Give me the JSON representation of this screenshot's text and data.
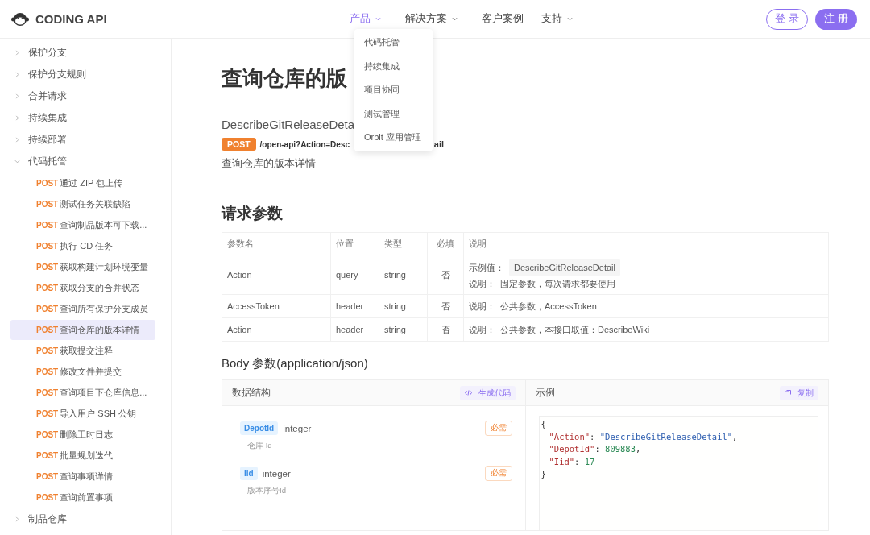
{
  "header": {
    "logo": "CODING API",
    "nav": [
      {
        "label": "产品",
        "selected": true,
        "caret": true
      },
      {
        "label": "解决方案",
        "selected": false,
        "caret": true
      },
      {
        "label": "客户案例",
        "selected": false,
        "caret": false
      },
      {
        "label": "支持",
        "selected": false,
        "caret": true
      }
    ],
    "login": "登 录",
    "register": "注 册"
  },
  "dropdown": [
    "代码托管",
    "持续集成",
    "项目协同",
    "测试管理",
    "Orbit 应用管理"
  ],
  "sidebar": [
    {
      "label": "保护分支",
      "expanded": false
    },
    {
      "label": "保护分支规则",
      "expanded": false
    },
    {
      "label": "合并请求",
      "expanded": false
    },
    {
      "label": "持续集成",
      "expanded": false
    },
    {
      "label": "持续部署",
      "expanded": false
    },
    {
      "label": "代码托管",
      "expanded": true,
      "children": [
        {
          "method": "POST",
          "label": "通过 ZIP 包上传",
          "selected": false
        },
        {
          "method": "POST",
          "label": "测试任务关联缺陷",
          "selected": false
        },
        {
          "method": "POST",
          "label": "查询制品版本可下载...",
          "selected": false
        },
        {
          "method": "POST",
          "label": "执行 CD 任务",
          "selected": false
        },
        {
          "method": "POST",
          "label": "获取构建计划环境变量",
          "selected": false
        },
        {
          "method": "POST",
          "label": "获取分支的合并状态",
          "selected": false
        },
        {
          "method": "POST",
          "label": "查询所有保护分支成员",
          "selected": false
        },
        {
          "method": "POST",
          "label": "查询仓库的版本详情",
          "selected": true
        },
        {
          "method": "POST",
          "label": "获取提交注释",
          "selected": false
        },
        {
          "method": "POST",
          "label": "修改文件并提交",
          "selected": false
        },
        {
          "method": "POST",
          "label": "查询项目下仓库信息...",
          "selected": false
        },
        {
          "method": "POST",
          "label": "导入用户 SSH 公钥",
          "selected": false
        },
        {
          "method": "POST",
          "label": "删除工时日志",
          "selected": false
        },
        {
          "method": "POST",
          "label": "批量规划迭代",
          "selected": false
        },
        {
          "method": "POST",
          "label": "查询事项详情",
          "selected": false
        },
        {
          "method": "POST",
          "label": "查询前置事项",
          "selected": false
        }
      ]
    },
    {
      "label": "制品仓库",
      "expanded": false
    }
  ],
  "page": {
    "title": "查询仓库的版",
    "action": "DescribeGitReleaseDeta",
    "method": "POST",
    "path": "/open-api?Action=Desc",
    "path_tail": "ail",
    "description": "查询仓库的版本详情"
  },
  "params": {
    "heading": "请求参数",
    "columns": [
      "参数名",
      "位置",
      "类型",
      "必填",
      "说明"
    ],
    "rows": [
      {
        "name": "Action",
        "in": "query",
        "type": "string",
        "required": "否",
        "notes": [
          {
            "kind": "example",
            "label": "示例值：",
            "value": "DescribeGitReleaseDetail"
          },
          {
            "kind": "note",
            "label": "说明：",
            "value": "固定参数，每次请求都要使用"
          }
        ]
      },
      {
        "name": "AccessToken",
        "in": "header",
        "type": "string",
        "required": "否",
        "notes": [
          {
            "kind": "note",
            "label": "说明：",
            "value": "公共参数，AccessToken"
          }
        ]
      },
      {
        "name": "Action",
        "in": "header",
        "type": "string",
        "required": "否",
        "notes": [
          {
            "kind": "note",
            "label": "说明：",
            "value": "公共参数，本接口取值：DescribeWiki"
          }
        ]
      }
    ]
  },
  "body": {
    "heading": "Body 参数(application/json)",
    "schema_title": "数据结构",
    "generate": "生成代码",
    "example_title": "示例",
    "copy": "复制",
    "fields": [
      {
        "name": "DepotId",
        "type": "integer",
        "required": "必需",
        "description": "仓库 Id"
      },
      {
        "name": "Iid",
        "type": "integer",
        "required": "必需",
        "description": "版本序号Id"
      }
    ],
    "code": [
      [
        {
          "kind": "punct",
          "text": "{"
        }
      ],
      [
        {
          "kind": "key",
          "text": "\"Action\""
        },
        {
          "kind": "punct",
          "text": ": "
        },
        {
          "kind": "string",
          "text": "\"DescribeGitReleaseDetail\""
        },
        {
          "kind": "punct",
          "text": ","
        }
      ],
      [
        {
          "kind": "key",
          "text": "\"DepotId\""
        },
        {
          "kind": "punct",
          "text": ": "
        },
        {
          "kind": "number",
          "text": "809883"
        },
        {
          "kind": "punct",
          "text": ","
        }
      ],
      [
        {
          "kind": "key",
          "text": "\"Iid\""
        },
        {
          "kind": "punct",
          "text": ": "
        },
        {
          "kind": "number",
          "text": "17"
        }
      ],
      [
        {
          "kind": "punct",
          "text": "}"
        }
      ]
    ]
  }
}
